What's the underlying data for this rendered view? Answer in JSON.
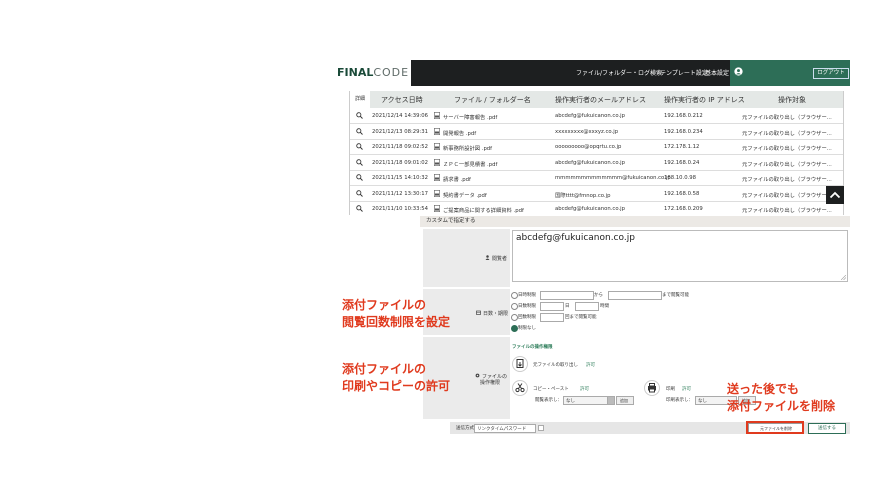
{
  "header": {
    "logo_bold": "FINAL",
    "logo_thin": "CODE",
    "nav": [
      "ファイル/フォルダー・ログ検索",
      "テンプレート設定",
      "基本設定"
    ],
    "logout": "ログアウト"
  },
  "table": {
    "detail_col": "詳細",
    "columns": [
      "アクセス日時",
      "ファイル / フォルダー名",
      "操作実行者のメールアドレス",
      "操作実行者の IP アドレス",
      "操作対象"
    ],
    "rows": [
      {
        "date": "2021/12/14 14:39:06",
        "file": "サーバー障害報告 .pdf",
        "email": "abcdefg@fukuicanon.co.jp",
        "ip": "192.168.0.212",
        "target": "元ファイルの取り出し（ブラウザー..."
      },
      {
        "date": "2021/12/13 08:29:31",
        "file": "開発報告 .pdf",
        "email": "xxxxxxxxx@xxxyz.co.jp",
        "ip": "192.168.0.234",
        "target": "元ファイルの取り出し（ブラウザー..."
      },
      {
        "date": "2021/11/18 09:02:52",
        "file": "新事務所設計図 .pdf",
        "email": "ooooooooo@opqrtu.co.jp",
        "ip": "172.178.1.12",
        "target": "元ファイルの取り出し（ブラウザー..."
      },
      {
        "date": "2021/11/18 09:01:02",
        "file": "ＺＰＣ一部見積書 .pdf",
        "email": "abcdefg@fukuicanon.co.jp",
        "ip": "192.168.0.24",
        "target": "元ファイルの取り出し（ブラウザー..."
      },
      {
        "date": "2021/11/15 14:10:32",
        "file": "請求書 .pdf",
        "email": "mmmmmmmmmmmmm@fukuicanon.co.jp",
        "ip": "168.10.0.98",
        "target": "元ファイルの取り出し（ブラウザー..."
      },
      {
        "date": "2021/11/12 13:30:17",
        "file": "契約書データ .pdf",
        "email": "国際tttt@fmnop.co.jp",
        "ip": "192.168.0.58",
        "target": "元ファイルの取り出し（ブラウザー"
      },
      {
        "date": "2021/11/10 10:33:54",
        "file": "ご提案商品に関する詳細資料 .pdf",
        "email": "abcdefg@fukuicanon.co.jp",
        "ip": "172.168.0.209",
        "target": "元ファイルの取り出し（ブラウザー..."
      }
    ]
  },
  "form": {
    "custom_heading": "カスタムで指定する",
    "recipient_label": "閲覧者",
    "recipient_value": "abcdefg@fukuicanon.co.jp",
    "period_label": "日数・期限",
    "period_options": [
      {
        "label": "日時制限",
        "suffix": "から",
        "suffix2": "まで閲覧可能"
      },
      {
        "label": "日数制限",
        "suffix": "日",
        "suffix2": "時間"
      },
      {
        "label": "回数制限",
        "suffix": "",
        "suffix2": "回まで閲覧可能"
      },
      {
        "label": "制限なし"
      }
    ],
    "ops_label_line1": "ファイルの",
    "ops_label_line2": "操作権限",
    "ops_heading": "ファイルの操作権限",
    "extract_label": "元ファイルの取り出し",
    "extract_value": "許可",
    "copy_label": "コピー・ペースト",
    "copy_value": "許可",
    "print_label": "印刷",
    "print_value": "許可",
    "display_label": "閲覧表示し：",
    "display_value": "なし",
    "display_btn": "追加",
    "print_display_label": "印刷表示し：",
    "print_display_value": "なし",
    "print_display_btn": "追加",
    "footer_label": "送信方式",
    "footer_select": "リンクタイムパスワード",
    "footer_checkbox": "",
    "delete_button": "元ファイルを削除",
    "send_button": "送信する"
  },
  "annotations": {
    "a1": [
      "添付ファイルの",
      "閲覧回数制限を設定"
    ],
    "a2": [
      "添付ファイルの",
      "印刷やコピーの許可"
    ],
    "a3": [
      "送った後でも",
      "添付ファイルを削除"
    ]
  },
  "colors": {
    "accent": "#e03a1e",
    "brand": "#2d6e57",
    "dark": "#1d1f20"
  }
}
